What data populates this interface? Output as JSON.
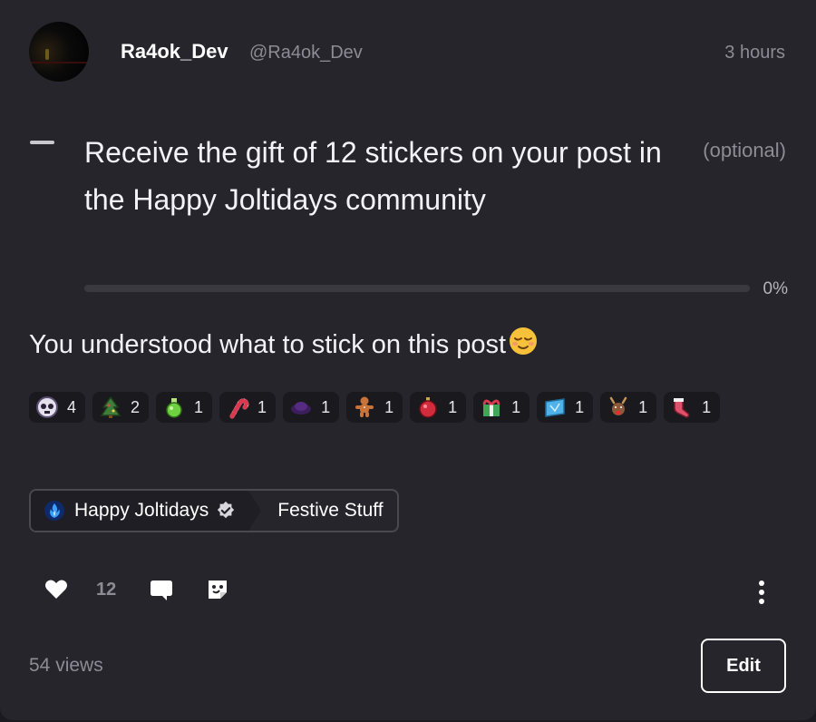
{
  "post": {
    "username": "Ra4ok_Dev",
    "handle": "@Ra4ok_Dev",
    "time": "3 hours",
    "body_text": "You understood what to stick on this post",
    "body_emoji": "😌"
  },
  "quest": {
    "text": "Receive the gift of 12 stickers on your post in the Happy Joltidays community",
    "optional_label": "(optional)",
    "progress_label": "0%",
    "progress_value": 0
  },
  "stickers": [
    {
      "icon": "skull-sticker-icon",
      "count": "4"
    },
    {
      "icon": "tree-sticker-icon",
      "count": "2"
    },
    {
      "icon": "potion-sticker-icon",
      "count": "1"
    },
    {
      "icon": "candy-cane-sticker-icon",
      "count": "1"
    },
    {
      "icon": "hat-sticker-icon",
      "count": "1"
    },
    {
      "icon": "gingerbread-sticker-icon",
      "count": "1"
    },
    {
      "icon": "ornament-sticker-icon",
      "count": "1"
    },
    {
      "icon": "gift-sticker-icon",
      "count": "1"
    },
    {
      "icon": "ice-sticker-icon",
      "count": "1"
    },
    {
      "icon": "reindeer-sticker-icon",
      "count": "1"
    },
    {
      "icon": "stocking-sticker-icon",
      "count": "1"
    }
  ],
  "community": {
    "name": "Happy Joltidays",
    "channel": "Festive Stuff"
  },
  "actions": {
    "like_count": "12"
  },
  "footer": {
    "views": "54 views",
    "edit_label": "Edit"
  },
  "colors": {
    "card_bg": "#26252c",
    "page_bg": "#1b1a20",
    "muted": "#8d8b93"
  }
}
